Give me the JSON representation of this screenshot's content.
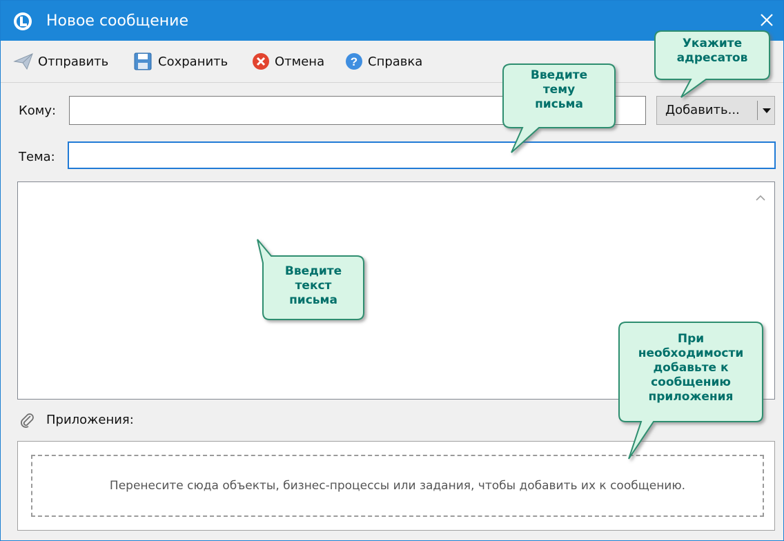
{
  "window": {
    "title": "Новое сообщение",
    "accent_color": "#1c86d8",
    "icon": "app-logo-icon",
    "close_icon": "close-icon"
  },
  "toolbar": {
    "send_label": "Отправить",
    "save_label": "Сохранить",
    "cancel_label": "Отмена",
    "help_label": "Справка",
    "icons": [
      "send-icon",
      "save-icon",
      "cancel-icon",
      "help-icon"
    ]
  },
  "form": {
    "to_label": "Кому:",
    "to_value": "",
    "add_button_label": "Добавить...",
    "subject_label": "Тема:",
    "subject_value": "",
    "body_value": ""
  },
  "attachments": {
    "label": "Приложения:",
    "drop_hint": "Перенесите сюда объекты, бизнес-процессы или задания, чтобы добавить их к сообщению."
  },
  "callouts": {
    "recipients": [
      "Укажите",
      "адресатов"
    ],
    "subject": [
      "Введите",
      "тему",
      "письма"
    ],
    "body": [
      "Введите",
      "текст",
      "письма"
    ],
    "attachments": [
      "При",
      "необходимости",
      "добавьте к",
      "сообщению",
      "приложения"
    ],
    "fill_color": "#d8f5e6",
    "border_color": "#2f8e6f",
    "text_color": "#00706a"
  }
}
